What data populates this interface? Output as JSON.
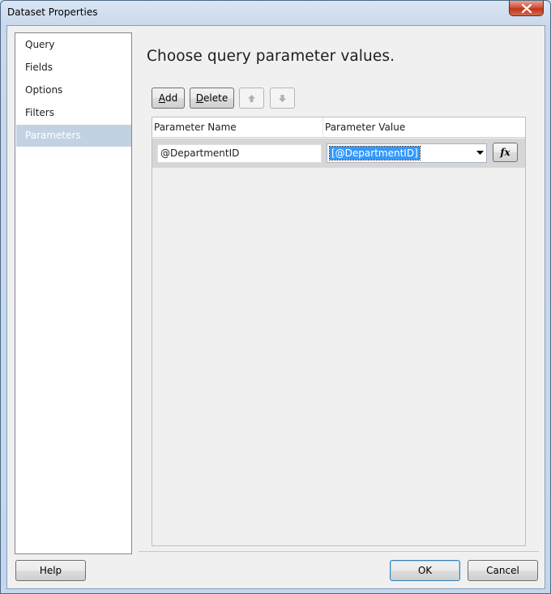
{
  "window": {
    "title": "Dataset Properties"
  },
  "nav": {
    "items": [
      {
        "label": "Query"
      },
      {
        "label": "Fields"
      },
      {
        "label": "Options"
      },
      {
        "label": "Filters"
      },
      {
        "label": "Parameters",
        "selected": true
      }
    ]
  },
  "main": {
    "heading": "Choose query parameter values.",
    "toolbar": {
      "add_label_mnemonic": "A",
      "add_label_rest": "dd",
      "delete_label_mnemonic": "D",
      "delete_label_rest": "elete",
      "move_up_icon": "arrow-up-icon",
      "move_down_icon": "arrow-down-icon"
    },
    "grid": {
      "columns": [
        "Parameter Name",
        "Parameter Value"
      ],
      "rows": [
        {
          "name": "@DepartmentID",
          "value": "[@DepartmentID]"
        }
      ],
      "expression_button_label": "fx"
    }
  },
  "footer": {
    "help_label": "Help",
    "ok_label": "OK",
    "cancel_label": "Cancel"
  },
  "colors": {
    "selected_nav": "#c3d2e2",
    "selection_highlight": "#3399ff",
    "close_button": "#c2351b"
  }
}
